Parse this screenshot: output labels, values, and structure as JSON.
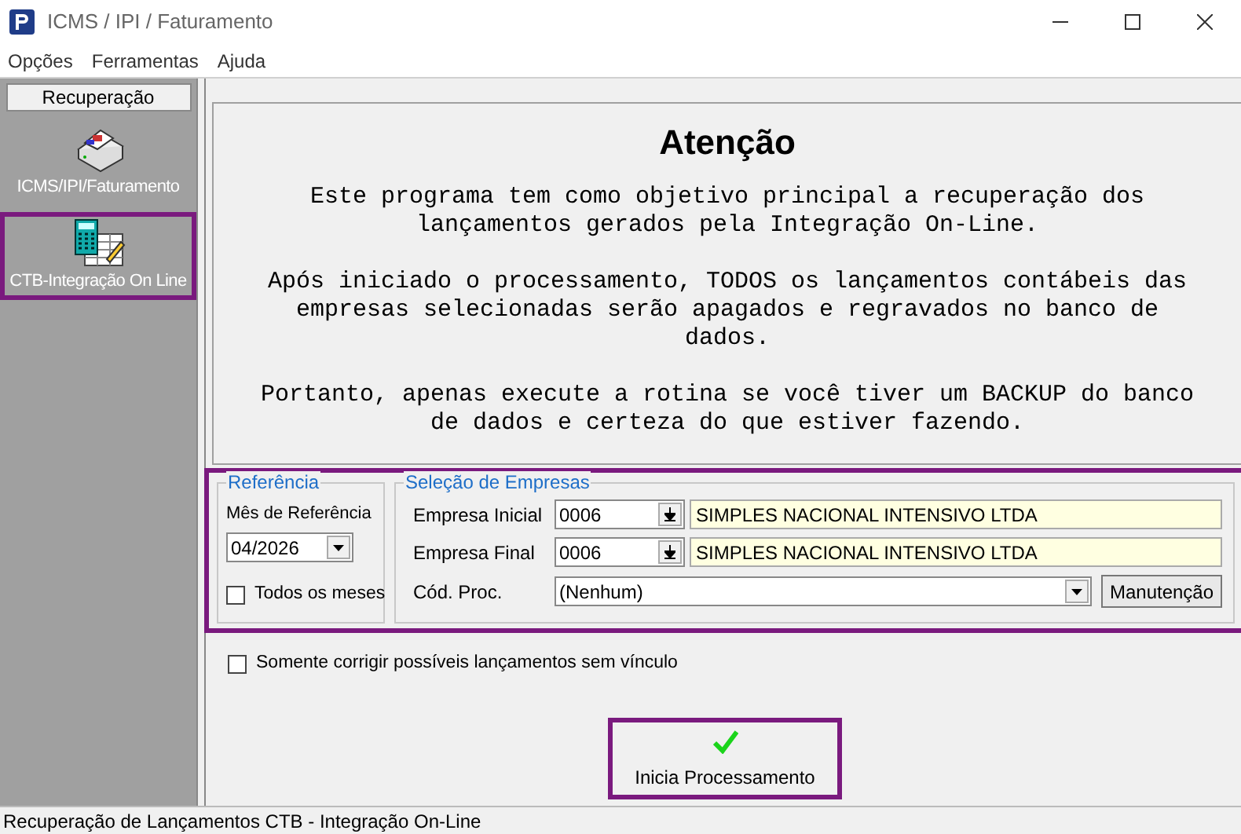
{
  "window": {
    "title": "ICMS / IPI / Faturamento"
  },
  "menu": [
    "Opções",
    "Ferramentas",
    "Ajuda"
  ],
  "sidebar": {
    "header": "Recuperação",
    "items": [
      {
        "label": "ICMS/IPI/Faturamento",
        "kind": "printer",
        "selected": false
      },
      {
        "label": "CTB-Integração On Line",
        "kind": "calculator",
        "selected": true
      }
    ]
  },
  "notice": {
    "title": "Atenção",
    "paragraphs": [
      "Este programa tem como objetivo principal a recuperação dos lançamentos gerados pela Integração On-Line.",
      "Após iniciado o processamento, TODOS os lançamentos contábeis das empresas selecionadas serão apagados e regravados no banco de dados.",
      "Portanto, apenas execute a rotina se você tiver um BACKUP do banco de dados e certeza do que estiver fazendo."
    ]
  },
  "filters": {
    "highlighted": true,
    "reference": {
      "title": "Referência",
      "label": "Mês de Referência",
      "month": "04/2026",
      "all_months": {
        "label": "Todos os meses",
        "checked": false
      }
    },
    "companies": {
      "title": "Seleção de Empresas",
      "rows": [
        {
          "label": "Empresa Inicial",
          "code": "0006",
          "name": "SIMPLES NACIONAL INTENSIVO LTDA"
        },
        {
          "label": "Empresa Final",
          "code": "0006",
          "name": "SIMPLES NACIONAL INTENSIVO LTDA"
        }
      ],
      "proc": {
        "label": "Cód. Proc.",
        "value": "(Nenhum)",
        "button": "Manutenção"
      }
    }
  },
  "only_fix": {
    "label": "Somente corrigir possíveis lançamentos sem vínculo",
    "checked": false
  },
  "start_button": {
    "label": "Inicia Processamento",
    "highlighted": true
  },
  "status_bar": "Recuperação de Lançamentos CTB - Integração On-Line"
}
